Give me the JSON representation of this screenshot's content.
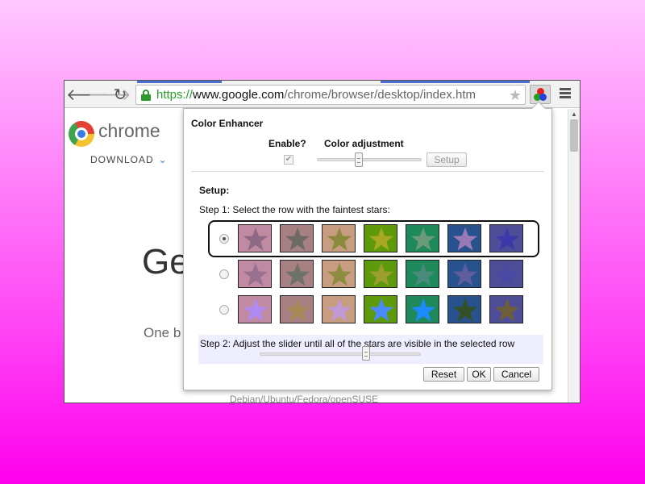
{
  "browser": {
    "address": {
      "scheme": "https://",
      "host": "www.google.com",
      "path": "/chrome/browser/desktop/index.htm"
    },
    "icons": {
      "back": "arrow-left-icon",
      "forward": "arrow-right-icon",
      "reload": "reload-icon",
      "bookmark": "star-icon",
      "extension": "color-enhancer-icon",
      "menu": "hamburger-menu-icon"
    },
    "back_glyph": "🡐",
    "forward_glyph": "🡒",
    "reload_glyph": "↻",
    "bookmark_glyph": "★"
  },
  "page": {
    "logo_text": "chrome",
    "download_label": "DOWNLOAD",
    "download_chevron": "⌄",
    "heading_partial": "Ge",
    "subtext_partial": "One b",
    "footer_text": "Debian/Ubuntu/Fedora/openSUSE"
  },
  "popup": {
    "title": "Color Enhancer",
    "enable_label": "Enable?",
    "enable_checked": true,
    "enable_check_glyph": "✔",
    "adjust_label": "Color adjustment",
    "adjust_value": 0.4,
    "setup_button": "Setup",
    "setup_heading": "Setup:",
    "step1_text": "Step 1: Select the row with the faintest stars:",
    "selected_row": 0,
    "rows": [
      [
        {
          "bg": "#c08aa2",
          "star": "#8f6a86"
        },
        {
          "bg": "#a78084",
          "star": "#6d6a66"
        },
        {
          "bg": "#c79c80",
          "star": "#8a8a3c"
        },
        {
          "bg": "#5e9a0c",
          "star": "#a8a822"
        },
        {
          "bg": "#1e8a5c",
          "star": "#6a9a7a"
        },
        {
          "bg": "#28528e",
          "star": "#9a7ab6"
        },
        {
          "bg": "#4e4e98",
          "star": "#3a3aaa"
        }
      ],
      [
        {
          "bg": "#c08aa2",
          "star": "#9a7090"
        },
        {
          "bg": "#a78084",
          "star": "#6e7268"
        },
        {
          "bg": "#c79c80",
          "star": "#8e8c40"
        },
        {
          "bg": "#5e9a0c",
          "star": "#9c9e30"
        },
        {
          "bg": "#1e8a5c",
          "star": "#4a8a7a"
        },
        {
          "bg": "#28528e",
          "star": "#5e5e9e"
        },
        {
          "bg": "#4e4e98",
          "star": "#4a4aa4"
        }
      ],
      [
        {
          "bg": "#c08aa2",
          "star": "#b08af0"
        },
        {
          "bg": "#a78084",
          "star": "#a78a56"
        },
        {
          "bg": "#c79c80",
          "star": "#c09ad6"
        },
        {
          "bg": "#5e9a0c",
          "star": "#4a8aff"
        },
        {
          "bg": "#1e8a5c",
          "star": "#1e8aff"
        },
        {
          "bg": "#28528e",
          "star": "#325024"
        },
        {
          "bg": "#4e4e98",
          "star": "#6e5e38"
        }
      ]
    ],
    "step2_text": "Step 2: Adjust the slider until all of the stars are visible in the selected row",
    "step2_value": 0.66,
    "buttons": {
      "reset": "Reset",
      "ok": "OK",
      "cancel": "Cancel"
    }
  }
}
